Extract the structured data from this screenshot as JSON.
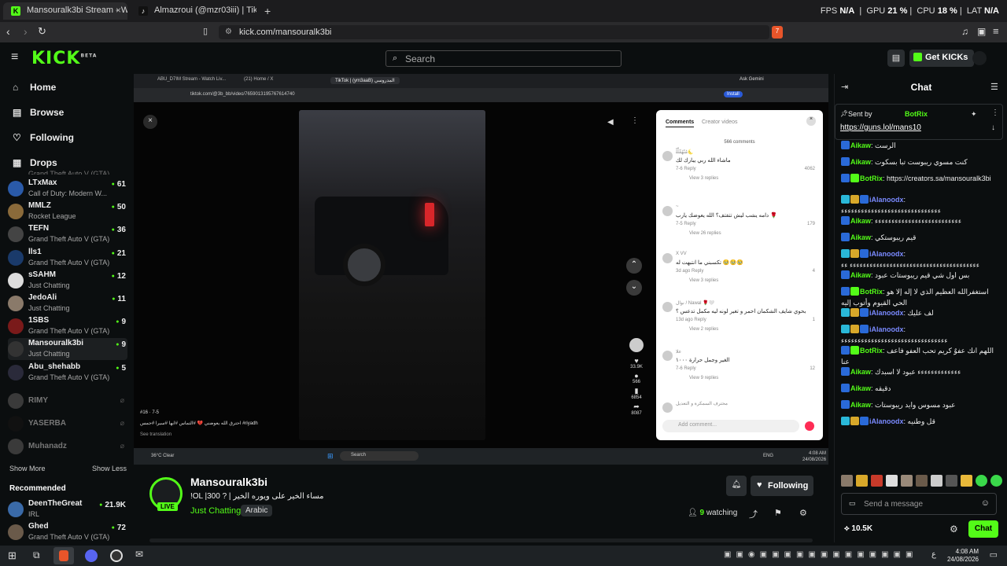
{
  "browser": {
    "tabs": [
      {
        "title": "Mansouralk3bi Stream - Watc",
        "favicon_color": "#53fc18"
      },
      {
        "title": "Almazroui (@mzr03iii) | TikTok",
        "favicon_color": "#ffffff"
      }
    ],
    "new_tab": "+",
    "perf": {
      "fps_label": "FPS",
      "fps": "N/A",
      "gpu_label": "GPU",
      "gpu": "21 %",
      "cpu_label": "CPU",
      "cpu": "18 %",
      "lat_label": "LAT",
      "lat": "N/A"
    },
    "url": "kick.com/mansouralk3bi",
    "shield_count": "7"
  },
  "kick": {
    "logo": "KICK",
    "logo_sup": "BETA",
    "search_placeholder": "Search",
    "get_kicks": "Get KICKs"
  },
  "sidebar": {
    "nav": [
      {
        "label": "Home",
        "icon": "home-icon"
      },
      {
        "label": "Browse",
        "icon": "browse-icon"
      },
      {
        "label": "Following",
        "icon": "heart-icon"
      },
      {
        "label": "Drops",
        "icon": "drops-icon"
      }
    ],
    "partial_game": "Grand Theft Auto V (GTA)",
    "following": [
      {
        "name": "LTxMax",
        "game": "Call of Duty: Modern W...",
        "viewers": "61",
        "color": "#2a5aa8"
      },
      {
        "name": "MMLZ",
        "game": "Rocket League",
        "viewers": "50",
        "color": "#8a6a3a"
      },
      {
        "name": "TEFN",
        "game": "Grand Theft Auto V (GTA)",
        "viewers": "36",
        "color": "#444"
      },
      {
        "name": "lls1",
        "game": "Grand Theft Auto V (GTA)",
        "viewers": "21",
        "color": "#1a3a6a"
      },
      {
        "name": "sSAHM",
        "game": "Just Chatting",
        "viewers": "12",
        "color": "#ddd"
      },
      {
        "name": "JedoAli",
        "game": "Just Chatting",
        "viewers": "11",
        "color": "#8a7a6a"
      },
      {
        "name": "1SBS",
        "game": "Grand Theft Auto V (GTA)",
        "viewers": "9",
        "color": "#7a1a1a"
      },
      {
        "name": "Mansouralk3bi",
        "game": "Just Chatting",
        "viewers": "9",
        "color": "#333"
      },
      {
        "name": "Abu_shehabb",
        "game": "Grand Theft Auto V (GTA)",
        "viewers": "5",
        "color": "#2a2a3a"
      }
    ],
    "offline": [
      "RIMY",
      "YASERBA",
      "Muhanadz"
    ],
    "show_more": "Show More",
    "show_less": "Show Less",
    "recommended_title": "Recommended",
    "recommended": [
      {
        "name": "DeenTheGreat",
        "game": "IRL",
        "viewers": "21.9K",
        "color": "#3a6aa8"
      },
      {
        "name": "Ghed",
        "game": "Grand Theft Auto V (GTA)",
        "viewers": "72",
        "color": "#6a5a4a"
      }
    ]
  },
  "video": {
    "inner_tabs": [
      "ABU_D7IM Stream - Watch Liv...",
      "(21) Home / X",
      "TikTok | (ym3aaB) المدروسي"
    ],
    "inner_url": "tiktok.com/@3b_bb/video/7659013195767614740",
    "ask_gemini": "Ask Gemini",
    "install": "Install",
    "comments_tab": "Comments",
    "creator_tab": "Creator videos",
    "comments_count": "566 comments",
    "comments": [
      {
        "user": "ﻣُﻨْﻬُﻣِّﻠِّﻠْ🌜",
        "text": "ماشاء الله ربي يبارك لك",
        "meta": "7-6  Reply",
        "likes": "4062",
        "replies": "View 3 replies"
      },
      {
        "user": "~",
        "text": "دامه يشب ليش تتفتف؟ الله يعوضك يارب 🌹",
        "meta": "7-5  Reply",
        "likes": "179",
        "replies": "View 26 replies"
      },
      {
        "user": "X VV",
        "text": "تكسبني ما انتبهت له 🥹🥹🥹",
        "meta": "3d ago  Reply",
        "likes": "4",
        "replies": "View 3 replies"
      },
      {
        "user": "نوال / Nawal 🌹🤍",
        "text": "بحوي شايف الشكمان احمر و تغير لونه ليه مكمل تدعس ؟",
        "meta": "13d ago  Reply",
        "likes": "1",
        "replies": "View 2 replies"
      },
      {
        "user": "علا",
        "text": "الغير وجمل حرارة ١٠٠٠",
        "meta": "7-6  Reply",
        "likes": "12",
        "replies": "View 9 replies"
      },
      {
        "user": "محترف السمكرة و التعديل",
        "text": "",
        "meta": "",
        "likes": "",
        "replies": ""
      }
    ],
    "add_comment": "Add comment...",
    "caption_num": "#16 · 7-5",
    "caption": "احترق الله يعوضني 💔 #التماس #ابها #سيرا #جمس #riyadh",
    "see_translation": "See translation",
    "likes": "33.9K",
    "comments_side": "566",
    "saves": "6854",
    "shares": "8087",
    "weather": "36°C Clear",
    "win_search": "Search",
    "lang": "ENG",
    "inner_time": "4:08 AM",
    "inner_date": "24/08/2026"
  },
  "stream": {
    "live": "LIVE",
    "name": "Mansouralk3bi",
    "title": "!OL |300 ? | مساء الخير على ويوره الخير",
    "category": "Just Chatting",
    "language": "Arabic",
    "following": "Following",
    "viewers": "9",
    "watching_label": "watching"
  },
  "chat": {
    "title": "Chat",
    "pinned": {
      "sent_by": "Sent by",
      "user": "BotRix",
      "link": "https://guns.lol/mans10"
    },
    "messages": [
      {
        "user": "Aikaw",
        "color": "#53fc18",
        "text": "الرست",
        "badges": [
          "#2a6ad8"
        ]
      },
      {
        "user": "Aikaw",
        "color": "#53fc18",
        "text": "كنت مسوي ريبوست تبا بسكوت",
        "badges": [
          "#2a6ad8"
        ]
      },
      {
        "user": "BotRix",
        "color": "#53fc18",
        "text": "https://creators.sa/mansouralk3bi",
        "badges": [
          "#2a6ad8",
          "#53fc18"
        ]
      },
      {
        "user": "iAlanoodx",
        "color": "#7a8aff",
        "text": "ءءءءءءءءءءءءءءءءءءءءءءءءءءءءءء",
        "badges": [
          "#2ab8d8",
          "#d8a82a",
          "#2a6ad8"
        ]
      },
      {
        "user": "Aikaw",
        "color": "#53fc18",
        "text": "ءءءءءءءءءءءءءءءءءءءءءءءءءء",
        "badges": [
          "#2a6ad8"
        ]
      },
      {
        "user": "Aikaw",
        "color": "#53fc18",
        "text": "قيم ريبوستكي",
        "badges": [
          "#2a6ad8"
        ]
      },
      {
        "user": "iAlanoodx",
        "color": "#7a8aff",
        "text": "ءءءءءءءءءءءءءءءءءءءءءءءءءءءءءءءءءءءءءءء ءء",
        "badges": [
          "#2ab8d8",
          "#d8a82a",
          "#2a6ad8"
        ]
      },
      {
        "user": "Aikaw",
        "color": "#53fc18",
        "text": "بس اول شي قيم ريبوستات عبود",
        "badges": [
          "#2a6ad8"
        ]
      },
      {
        "user": "BotRix",
        "color": "#53fc18",
        "text": "استغفرالله العظيم الذي لا إله إلا هو الحي القيوم وأتوب إليه",
        "badges": [
          "#2a6ad8",
          "#53fc18"
        ]
      },
      {
        "user": "iAlanoodx",
        "color": "#7a8aff",
        "text": "لف عليك",
        "badges": [
          "#2ab8d8",
          "#d8a82a",
          "#2a6ad8"
        ]
      },
      {
        "user": "iAlanoodx",
        "color": "#7a8aff",
        "text": "ءءءءءءءءءءءءءءءءءءءءءءءءءءءءءءءء",
        "badges": [
          "#2ab8d8",
          "#d8a82a",
          "#2a6ad8"
        ]
      },
      {
        "user": "BotRix",
        "color": "#53fc18",
        "text": "اللهم انك عفوٌ كريم تحب العفو فاعف عنا",
        "badges": [
          "#2a6ad8",
          "#53fc18"
        ]
      },
      {
        "user": "Aikaw",
        "color": "#53fc18",
        "text": "ءءءءءءءءءءءءء عبود لا اسبدك",
        "badges": [
          "#2a6ad8"
        ]
      },
      {
        "user": "Aikaw",
        "color": "#53fc18",
        "text": "دقيقه",
        "badges": [
          "#2a6ad8"
        ]
      },
      {
        "user": "Aikaw",
        "color": "#53fc18",
        "text": "عبود مسوس وايد ريبوستات",
        "badges": [
          "#2a6ad8"
        ]
      },
      {
        "user": "iAlanoodx",
        "color": "#7a8aff",
        "text": "قل وطنيه",
        "badges": [
          "#2ab8d8",
          "#d8a82a",
          "#2a6ad8"
        ]
      }
    ],
    "input_placeholder": "Send a message",
    "points": "10.5K",
    "send_label": "Chat"
  },
  "taskbar": {
    "time": "4:08 AM",
    "date": "24/08/2026",
    "lang": "ع"
  }
}
